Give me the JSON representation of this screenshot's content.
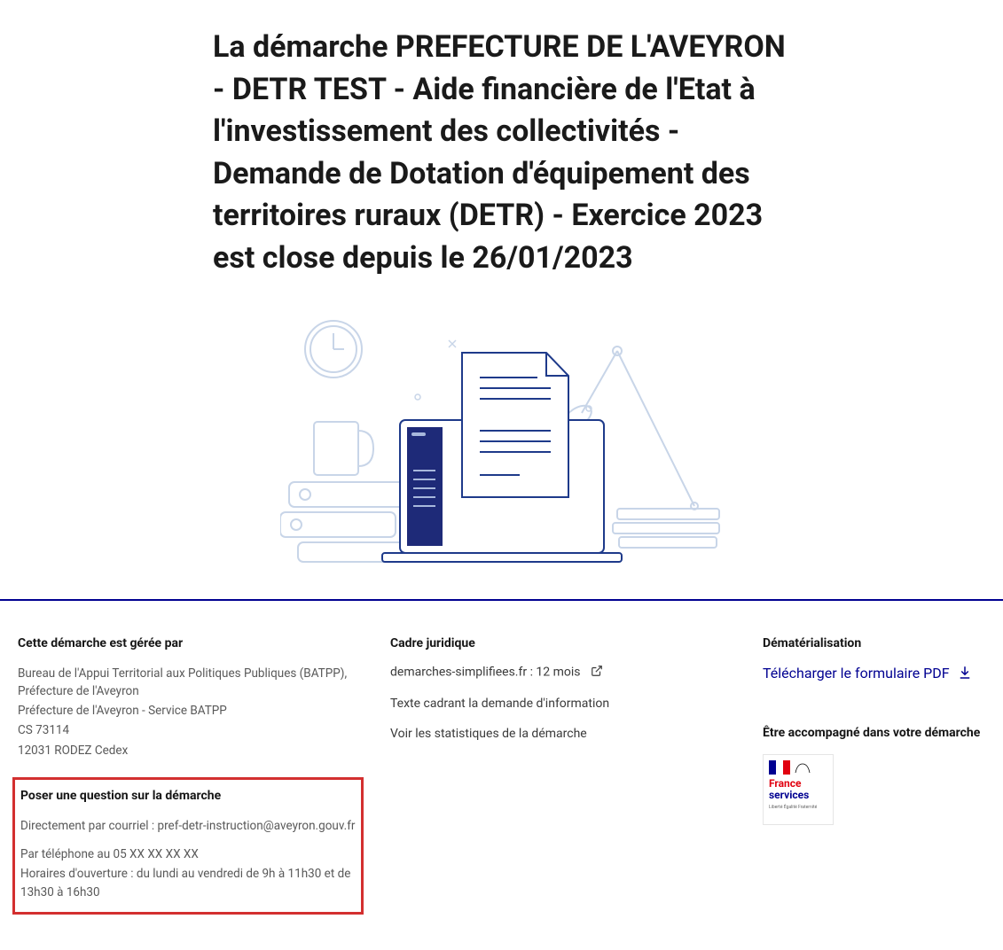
{
  "page_title": "La démarche PREFECTURE DE L'AVEYRON - DETR TEST - Aide financière de l'Etat à l'investissement des collectivités - Demande de Dotation d'équipement des territoires ruraux (DETR) - Exercice 2023 est close depuis le 26/01/2023",
  "footer": {
    "col1": {
      "heading": "Cette démarche est gérée par",
      "lines": [
        "Bureau de l'Appui Territorial aux Politiques Publiques (BATPP), Préfecture de l'Aveyron",
        "Préfecture de l'Aveyron - Service BATPP",
        "CS 73114",
        "12031 RODEZ Cedex"
      ],
      "question": {
        "heading": "Poser une question sur la démarche",
        "email_line": "Directement par courriel : pref-detr-instruction@aveyron.gouv.fr",
        "phone_line": "Par téléphone au 05 XX XX XX XX",
        "hours_line": "Horaires d'ouverture : du lundi au vendredi de 9h à 11h30 et de 13h30 à 16h30"
      }
    },
    "col2": {
      "heading": "Cadre juridique",
      "links": [
        {
          "label": "demarches-simplifiees.fr : 12 mois",
          "external": true
        },
        {
          "label": "Texte cadrant la demande d'information",
          "external": false
        },
        {
          "label": "Voir les statistiques de la démarche",
          "external": false
        }
      ]
    },
    "col3": {
      "heading": "Dématérialisation",
      "download_label": "Télécharger le formulaire PDF",
      "accompany_heading": "Être accompagné dans votre démarche",
      "logo": {
        "line1": "France",
        "line2": "services",
        "motto": "Liberté Égalité Fraternité"
      }
    }
  }
}
